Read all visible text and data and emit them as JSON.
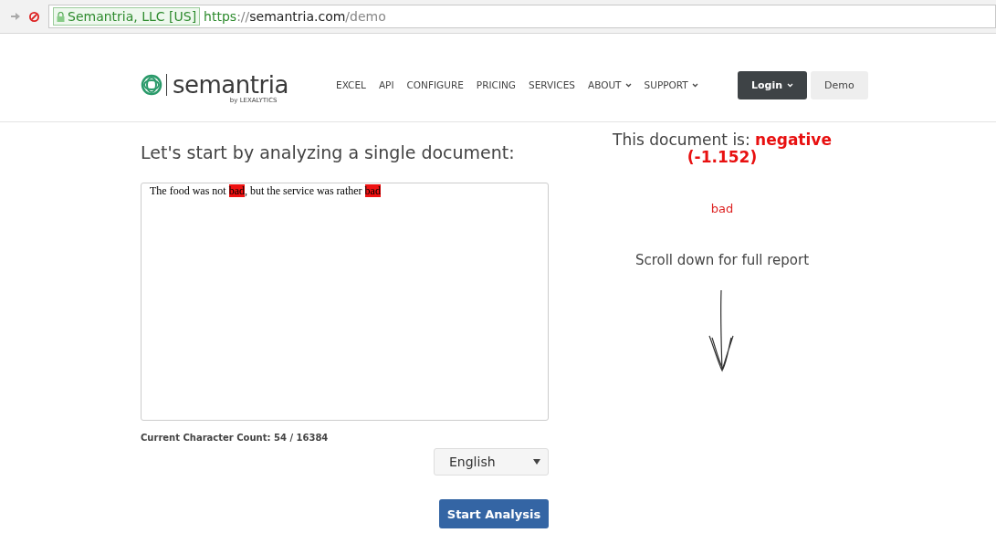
{
  "browser": {
    "identity": "Semantria, LLC [US]",
    "url": [
      {
        "kind": "scheme",
        "text": "https"
      },
      {
        "kind": "muted",
        "text": "://"
      },
      {
        "kind": "host",
        "text": "semantria.com"
      },
      {
        "kind": "muted",
        "text": "/demo"
      }
    ]
  },
  "header": {
    "logo": {
      "name": "semantria",
      "byline": "by LEXALYTICS"
    },
    "nav": [
      {
        "label": "EXCEL",
        "dropdown": false
      },
      {
        "label": "API",
        "dropdown": false
      },
      {
        "label": "CONFIGURE",
        "dropdown": false
      },
      {
        "label": "PRICING",
        "dropdown": false
      },
      {
        "label": "SERVICES",
        "dropdown": false
      },
      {
        "label": "ABOUT",
        "dropdown": true
      },
      {
        "label": "SUPPORT",
        "dropdown": true
      }
    ],
    "buttons": [
      {
        "label": "Login",
        "kind": "dark",
        "dropdown": true
      },
      {
        "label": "Demo",
        "kind": "light",
        "dropdown": false
      }
    ]
  },
  "left": {
    "heading": "Let's start by analyzing a single document:",
    "document": [
      {
        "text": "The food was not ",
        "highlighted": false
      },
      {
        "text": "bad",
        "highlighted": true
      },
      {
        "text": ", but the service was rather ",
        "highlighted": false
      },
      {
        "text": "bad",
        "highlighted": true
      }
    ],
    "char_count": "Current Character Count: 54 / 16384",
    "language": "English",
    "submit": "Start Analysis"
  },
  "right": {
    "prefix": "This document is: ",
    "sentiment": "negative",
    "score": "(-1.152)",
    "phrases": [
      "bad"
    ],
    "hint": "Scroll down for full report"
  }
}
